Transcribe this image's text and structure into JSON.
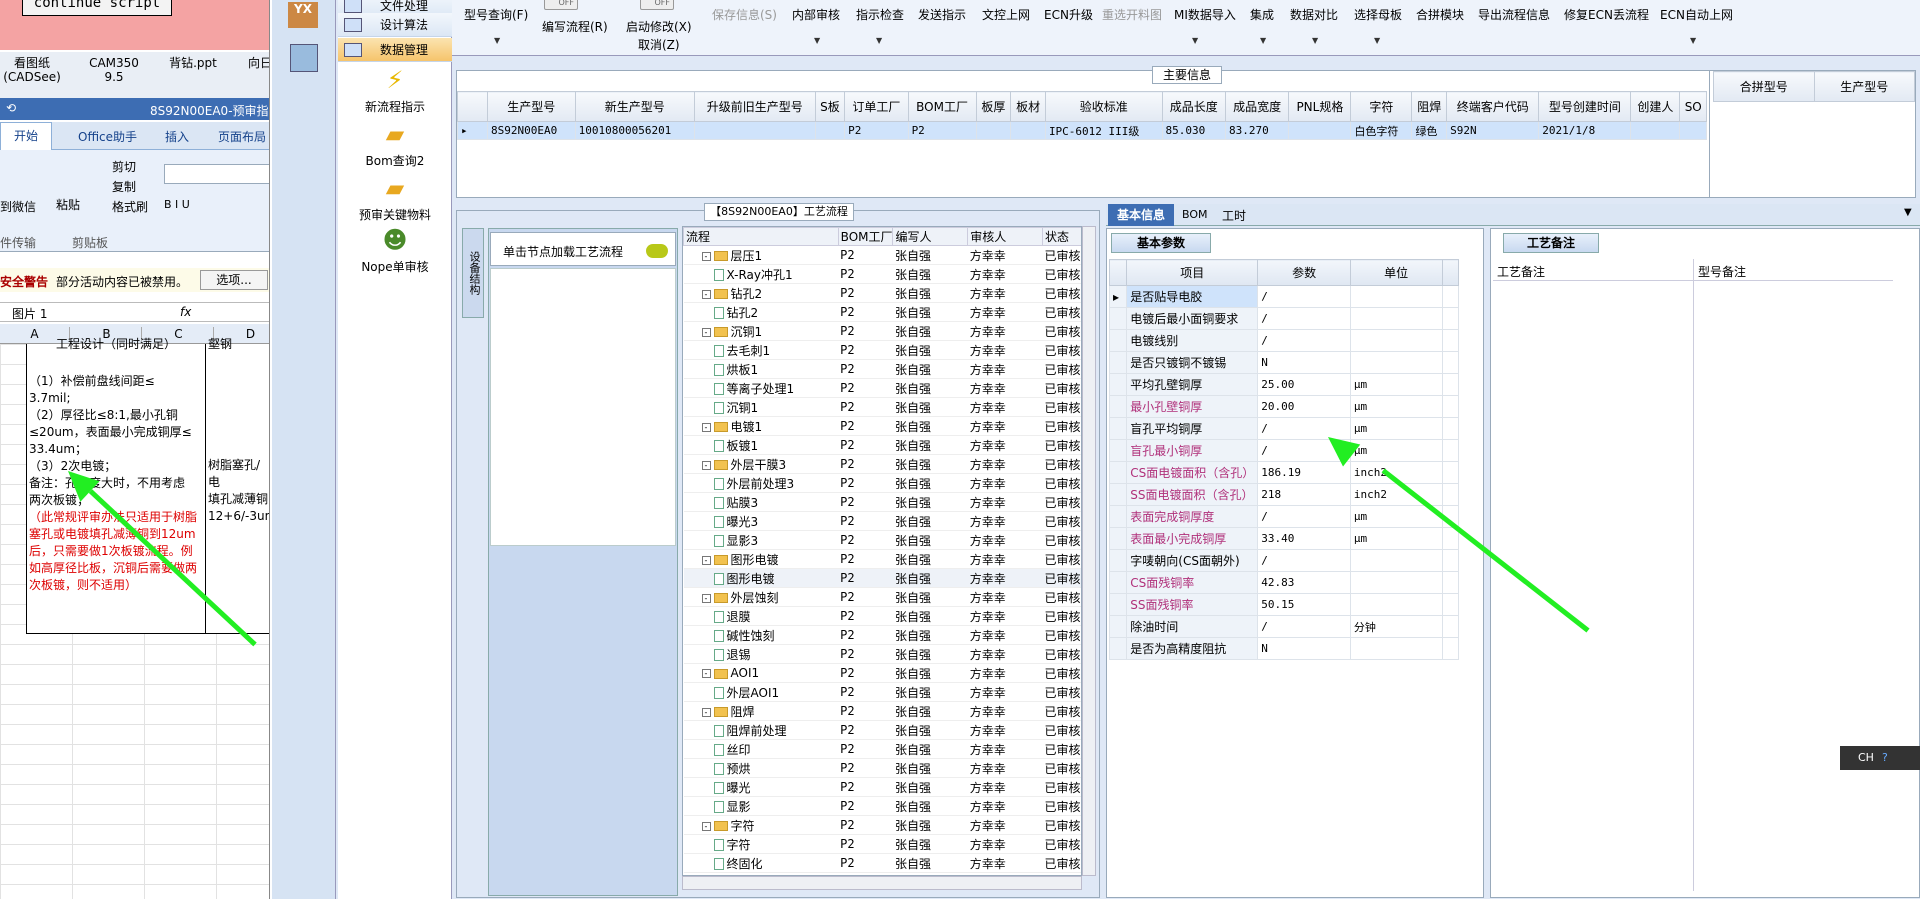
{
  "excel": {
    "continue_btn": "continue script",
    "desktop_icons": [
      "看图纸\n(CADSee)",
      "CAM350 9.5",
      "背钻.ppt",
      "向日"
    ],
    "window_title": "8S92N00EA0-预审指",
    "ribbon_tabs": [
      "开始",
      "Office助手",
      "插入",
      "页面布局"
    ],
    "clipboard": {
      "paste": "粘贴",
      "cut": "剪切",
      "copy": "复制",
      "format": "格式刷",
      "group": "剪贴板",
      "wechat": "到微信",
      "transfer": "件传输"
    },
    "security_warning": "安全警告",
    "security_msg": "部分活动内容已被禁用。",
    "options_btn": "选项...",
    "name_box": "图片 1",
    "fx": "fx",
    "columns": [
      "A",
      "B",
      "C",
      "D"
    ],
    "cell_header": "工程设计（同时满足）",
    "cell_header2": "壑钢",
    "cell_lines": [
      "（1）补偿前盘线间距≤",
      "3.7mil;",
      "（2）厚径比≤8:1,最小孔铜",
      "≤20um，表面最小完成铜厚≤",
      "33.4um；",
      "（3）2次电镀；",
      "备注：孔密度大时，不用考虑",
      "两次板镀；"
    ],
    "cell_red": "（此常规评审办法只适用于树脂塞孔或电镀填孔减薄铜到12um后，只需要做1次板镀流程。例如高厚径比板，沉铜后需要做两次板镀，则不适用）",
    "cell2_lines": [
      "树脂塞孔/电",
      "填孔减薄铜",
      "12+6/-3um"
    ]
  },
  "app": {
    "sb_labels": [
      "YX"
    ],
    "nav_items": [
      {
        "label": "文件处理"
      },
      {
        "label": "设计算法"
      },
      {
        "label": "数据管理"
      }
    ],
    "tools": [
      "新流程指示",
      "Bom查询2",
      "预审关键物料",
      "Nope单审核"
    ],
    "toolbar": [
      {
        "label": "型号查询(F)",
        "disabled": false
      },
      {
        "label": "编写流程(R)",
        "disabled": false
      },
      {
        "label": "启动修改(X)",
        "disabled": false
      },
      {
        "label": "取消(Z)",
        "disabled": false
      },
      {
        "label": "保存信息(S)",
        "disabled": true
      },
      {
        "label": "内部审核",
        "disabled": false
      },
      {
        "label": "指示检查",
        "disabled": false
      },
      {
        "label": "发送指示",
        "disabled": false
      },
      {
        "label": "文控上网",
        "disabled": false
      },
      {
        "label": "ECN升级",
        "disabled": false
      },
      {
        "label": "重选开料图",
        "disabled": true
      },
      {
        "label": "MI数据导入",
        "disabled": false
      },
      {
        "label": "集成",
        "disabled": false
      },
      {
        "label": "数据对比",
        "disabled": false
      },
      {
        "label": "选择母板",
        "disabled": false
      },
      {
        "label": "合拼模块",
        "disabled": false
      },
      {
        "label": "导出流程信息",
        "disabled": false
      },
      {
        "label": "修复ECN丢流程",
        "disabled": false
      },
      {
        "label": "ECN自动上网",
        "disabled": false
      }
    ],
    "toggle_off": "OFF"
  },
  "main_info": {
    "label": "主要信息",
    "headers": [
      "生产型号",
      "新生产型号",
      "升级前旧生产型号",
      "S板",
      "订单工厂",
      "BOM工厂",
      "板厚",
      "板材",
      "验收标准",
      "成品长度",
      "成品宽度",
      "PNL规格",
      "字符",
      "阻焊",
      "终端客户代码",
      "型号创建时间",
      "创建人",
      "SO"
    ],
    "row": [
      "8S92N00EA0",
      "10010800056201",
      "",
      "",
      "P2",
      "P2",
      "",
      "",
      "IPC-6012 III级",
      "85.030",
      "83.270",
      "",
      "白色字符",
      "绿色",
      "S92N",
      "2021/1/8",
      "",
      ""
    ],
    "side_headers": [
      "合拼型号",
      "生产型号"
    ]
  },
  "process": {
    "label": "【8S92N00EA0】工艺流程",
    "vtab": "设备结构",
    "load_btn": "单击节点加载工艺流程",
    "headers": [
      "流程",
      "BOM工厂",
      "编写人",
      "审核人",
      "状态"
    ],
    "rows": [
      {
        "name": "层压1",
        "level": 1,
        "folder": true
      },
      {
        "name": "X-Ray冲孔1",
        "level": 2,
        "folder": false
      },
      {
        "name": "钻孔2",
        "level": 1,
        "folder": true
      },
      {
        "name": "钻孔2",
        "level": 2,
        "folder": false
      },
      {
        "name": "沉铜1",
        "level": 1,
        "folder": true
      },
      {
        "name": "去毛刺1",
        "level": 2,
        "folder": false
      },
      {
        "name": "烘板1",
        "level": 2,
        "folder": false
      },
      {
        "name": "等离子处理1",
        "level": 2,
        "folder": false
      },
      {
        "name": "沉铜1",
        "level": 2,
        "folder": false
      },
      {
        "name": "电镀1",
        "level": 1,
        "folder": true
      },
      {
        "name": "板镀1",
        "level": 2,
        "folder": false
      },
      {
        "name": "外层干膜3",
        "level": 1,
        "folder": true
      },
      {
        "name": "外层前处理3",
        "level": 2,
        "folder": false
      },
      {
        "name": "贴膜3",
        "level": 2,
        "folder": false
      },
      {
        "name": "曝光3",
        "level": 2,
        "folder": false
      },
      {
        "name": "显影3",
        "level": 2,
        "folder": false
      },
      {
        "name": "图形电镀",
        "level": 1,
        "folder": true
      },
      {
        "name": "图形电镀",
        "level": 2,
        "folder": false
      },
      {
        "name": "外层蚀刻",
        "level": 1,
        "folder": true
      },
      {
        "name": "退膜",
        "level": 2,
        "folder": false
      },
      {
        "name": "碱性蚀刻",
        "level": 2,
        "folder": false
      },
      {
        "name": "退锡",
        "level": 2,
        "folder": false
      },
      {
        "name": "AOI1",
        "level": 1,
        "folder": true
      },
      {
        "name": "外层AOI1",
        "level": 2,
        "folder": false
      },
      {
        "name": "阻焊",
        "level": 1,
        "folder": true
      },
      {
        "name": "阻焊前处理",
        "level": 2,
        "folder": false
      },
      {
        "name": "丝印",
        "level": 2,
        "folder": false
      },
      {
        "name": "预烘",
        "level": 2,
        "folder": false
      },
      {
        "name": "曝光",
        "level": 2,
        "folder": false
      },
      {
        "name": "显影",
        "level": 2,
        "folder": false
      },
      {
        "name": "字符",
        "level": 1,
        "folder": true
      },
      {
        "name": "字符",
        "level": 2,
        "folder": false
      },
      {
        "name": "终固化",
        "level": 2,
        "folder": false
      }
    ],
    "bom": "P2",
    "writer": "张自强",
    "reviewer": "方幸幸",
    "status": "已审核"
  },
  "info": {
    "tabs": [
      "基本信息",
      "BOM",
      "工时"
    ],
    "basic_tab": "基本参数",
    "notes_tab": "工艺备注",
    "notes_cols": [
      "工艺备注",
      "型号备注"
    ],
    "param_headers": [
      "项目",
      "参数",
      "单位"
    ],
    "params": [
      {
        "item": "是否贴导电胶",
        "value": "/",
        "unit": "",
        "pink": false
      },
      {
        "item": "电镀后最小面铜要求",
        "value": "/",
        "unit": "",
        "pink": false
      },
      {
        "item": "电镀线别",
        "value": "/",
        "unit": "",
        "pink": false
      },
      {
        "item": "是否只镀铜不镀锡",
        "value": "N",
        "unit": "",
        "pink": false
      },
      {
        "item": "平均孔壁铜厚",
        "value": "25.00",
        "unit": "μm",
        "pink": false
      },
      {
        "item": "最小孔壁铜厚",
        "value": "20.00",
        "unit": "μm",
        "pink": true
      },
      {
        "item": "盲孔平均铜厚",
        "value": "/",
        "unit": "μm",
        "pink": false
      },
      {
        "item": "盲孔最小铜厚",
        "value": "/",
        "unit": "μm",
        "pink": true
      },
      {
        "item": "CS面电镀面积（含孔）",
        "value": "186.19",
        "unit": "inch2",
        "pink": true
      },
      {
        "item": "SS面电镀面积（含孔）",
        "value": "218",
        "unit": "inch2",
        "pink": true
      },
      {
        "item": "表面完成铜厚度",
        "value": "/",
        "unit": "μm",
        "pink": true
      },
      {
        "item": "表面最小完成铜厚",
        "value": "33.40",
        "unit": "μm",
        "pink": true
      },
      {
        "item": "字唛朝向(CS面朝外)",
        "value": "/",
        "unit": "",
        "pink": false
      },
      {
        "item": "CS面残铜率",
        "value": "42.83",
        "unit": "",
        "pink": true
      },
      {
        "item": "SS面残铜率",
        "value": "50.15",
        "unit": "",
        "pink": true
      },
      {
        "item": "除油时间",
        "value": "/",
        "unit": "分钟",
        "pink": false
      },
      {
        "item": "是否为高精度阻抗",
        "value": "N",
        "unit": "",
        "pink": false
      }
    ]
  },
  "ime": "CH",
  "colors": {
    "accent": "#3d6db3",
    "arrow": "#22ee22",
    "pink_label": "#b0307a"
  }
}
